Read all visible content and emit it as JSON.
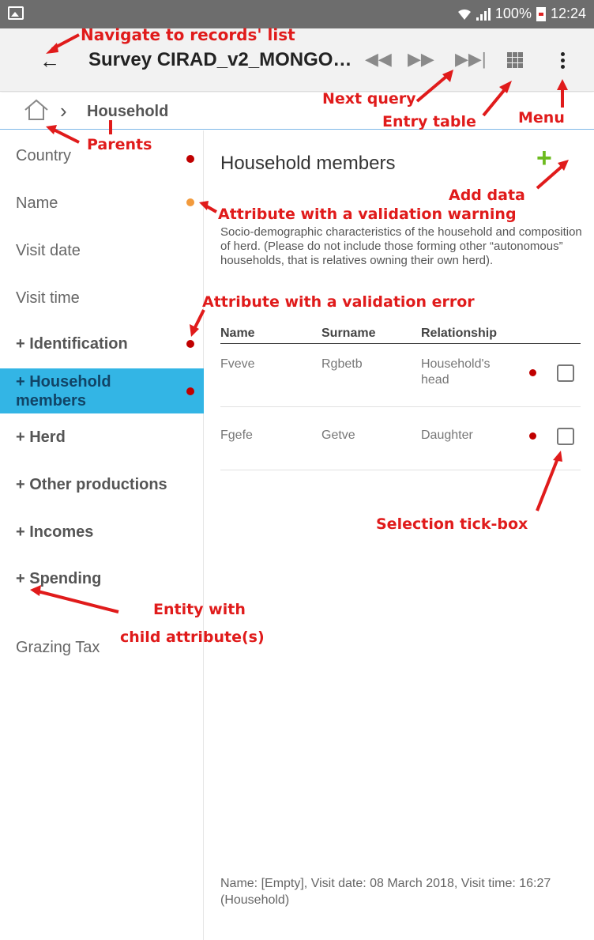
{
  "statusbar": {
    "battery": "100%",
    "time": "12:24"
  },
  "toolbar": {
    "back_icon": "arrow-left-icon",
    "title": "Survey CIRAD_v2_MONGO…",
    "buttons": [
      "fast-rewind-icon",
      "fast-forward-icon",
      "skip-next-icon",
      "grid-icon",
      "more-vert-icon"
    ]
  },
  "breadcrumb": {
    "current": "Household"
  },
  "sidebar": {
    "items": [
      {
        "label": "Country",
        "dot": "#c00000"
      },
      {
        "label": "Name",
        "dot": "#f29a3c"
      },
      {
        "label": "Visit date"
      },
      {
        "label": "Visit time"
      },
      {
        "label": "+ Identification",
        "dot": "#c00000"
      },
      {
        "label": "+ Household members",
        "dot": "#c00000",
        "selected": true
      },
      {
        "label": "+ Herd"
      },
      {
        "label": "+ Other productions"
      },
      {
        "label": "+ Incomes"
      },
      {
        "label": "+ Spending"
      },
      {
        "label": "Grazing Tax"
      }
    ]
  },
  "main": {
    "heading": "Household members",
    "add_icon": "+",
    "description": "Socio-demographic characteristics of the household and composition of herd. (Please do not include those forming other “autonomous” households, that is relatives owning their own herd).",
    "table": {
      "headers": [
        "Name",
        "Surname",
        "Relationship"
      ],
      "rows": [
        {
          "name": "Fveve",
          "surname": "Rgbetb",
          "relationship": "Household's head"
        },
        {
          "name": "Fgefe",
          "surname": "Getve",
          "relationship": "Daughter"
        }
      ]
    },
    "footer": "Name: [Empty], Visit date: 08 March 2018, Visit time: 16:27 (Household)"
  },
  "annotations": {
    "navigate": "Navigate to records' list",
    "next_query": "Next query",
    "entry_table": "Entry table",
    "menu": "Menu",
    "parents": "Parents",
    "add_data": "Add data",
    "validation_warning": "Attribute with a validation warning",
    "validation_error": "Attribute with a validation error",
    "selection_tickbox": "Selection tick-box",
    "entity_child_1": "Entity with",
    "entity_child_2": "child attribute(s)"
  }
}
